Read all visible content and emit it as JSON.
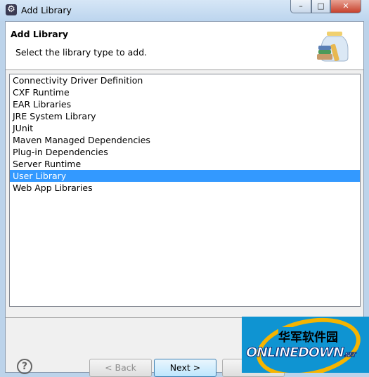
{
  "window": {
    "title": "Add Library",
    "minimize": "–",
    "maximize": "□",
    "close": "✕"
  },
  "header": {
    "title": "Add Library",
    "description": "Select the library type to add.",
    "icon": "library-jar-icon"
  },
  "list": {
    "items": [
      "Connectivity Driver Definition",
      "CXF Runtime",
      "EAR Libraries",
      "JRE System Library",
      "JUnit",
      "Maven Managed Dependencies",
      "Plug-in Dependencies",
      "Server Runtime",
      "User Library",
      "Web App Libraries"
    ],
    "selected": "User Library",
    "selection_color": "#3399ff"
  },
  "footer": {
    "help": "?",
    "back": "< Back",
    "next": "Next >",
    "finish": ""
  },
  "watermark": {
    "cn": "华军软件园",
    "en": "ONLINEDOWN",
    "net": ".NET"
  }
}
